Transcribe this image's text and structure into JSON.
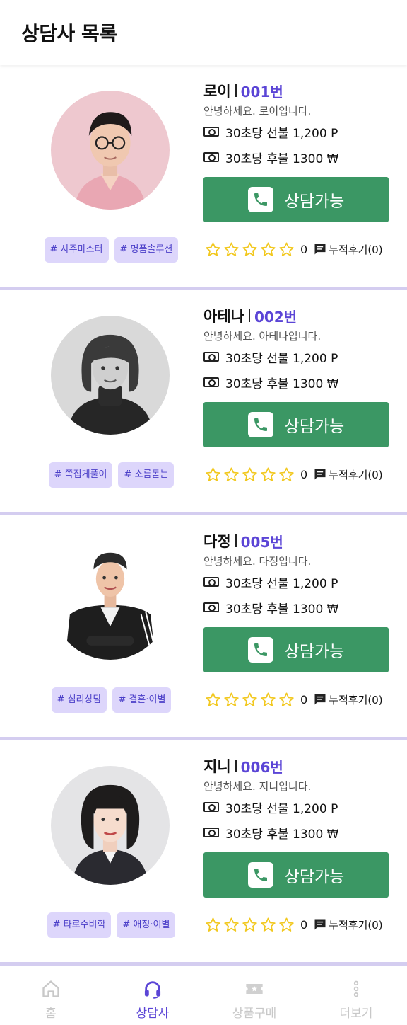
{
  "header": {
    "title": "상담사 목록"
  },
  "counselors": [
    {
      "name": "로이",
      "number": "001번",
      "greeting": "안녕하세요. 로이입니다.",
      "price_prepaid": "30초당 선불 1,200 P",
      "price_postpaid": "30초당 후불 1300 ₩",
      "call_label": "상담가능",
      "rating_count": "0",
      "review_label": "누적후기(0)",
      "tags": [
        "# 사주마스터",
        "# 명품솔루션"
      ],
      "avatar": "man-glasses-pink"
    },
    {
      "name": "아테나",
      "number": "002번",
      "greeting": "안녕하세요. 아테나입니다.",
      "price_prepaid": "30초당 선불 1,200 P",
      "price_postpaid": "30초당 후불 1300 ₩",
      "call_label": "상담가능",
      "rating_count": "0",
      "review_label": "누적후기(0)",
      "tags": [
        "# 쪽집게풀이",
        "# 소름돋는"
      ],
      "avatar": "woman-bw"
    },
    {
      "name": "다정",
      "number": "005번",
      "greeting": "안녕하세요. 다정입니다.",
      "price_prepaid": "30초당 선불 1,200 P",
      "price_postpaid": "30초당 후불 1300 ₩",
      "call_label": "상담가능",
      "rating_count": "0",
      "review_label": "누적후기(0)",
      "tags": [
        "# 심리상담",
        "# 결혼·이별"
      ],
      "avatar": "woman-blazer"
    },
    {
      "name": "지니",
      "number": "006번",
      "greeting": "안녕하세요. 지니입니다.",
      "price_prepaid": "30초당 선불 1,200 P",
      "price_postpaid": "30초당 후불 1300 ₩",
      "call_label": "상담가능",
      "rating_count": "0",
      "review_label": "누적후기(0)",
      "tags": [
        "# 타로수비학",
        "# 애정·이별"
      ],
      "avatar": "woman-bangs"
    }
  ],
  "tabbar": {
    "home": "홈",
    "counselors": "상담사",
    "shop": "상품구매",
    "more": "더보기"
  },
  "colors": {
    "accent": "#5b45d6",
    "call_button": "#3b9764",
    "tag_bg": "#ddd6fb",
    "star": "#f2c81e"
  }
}
